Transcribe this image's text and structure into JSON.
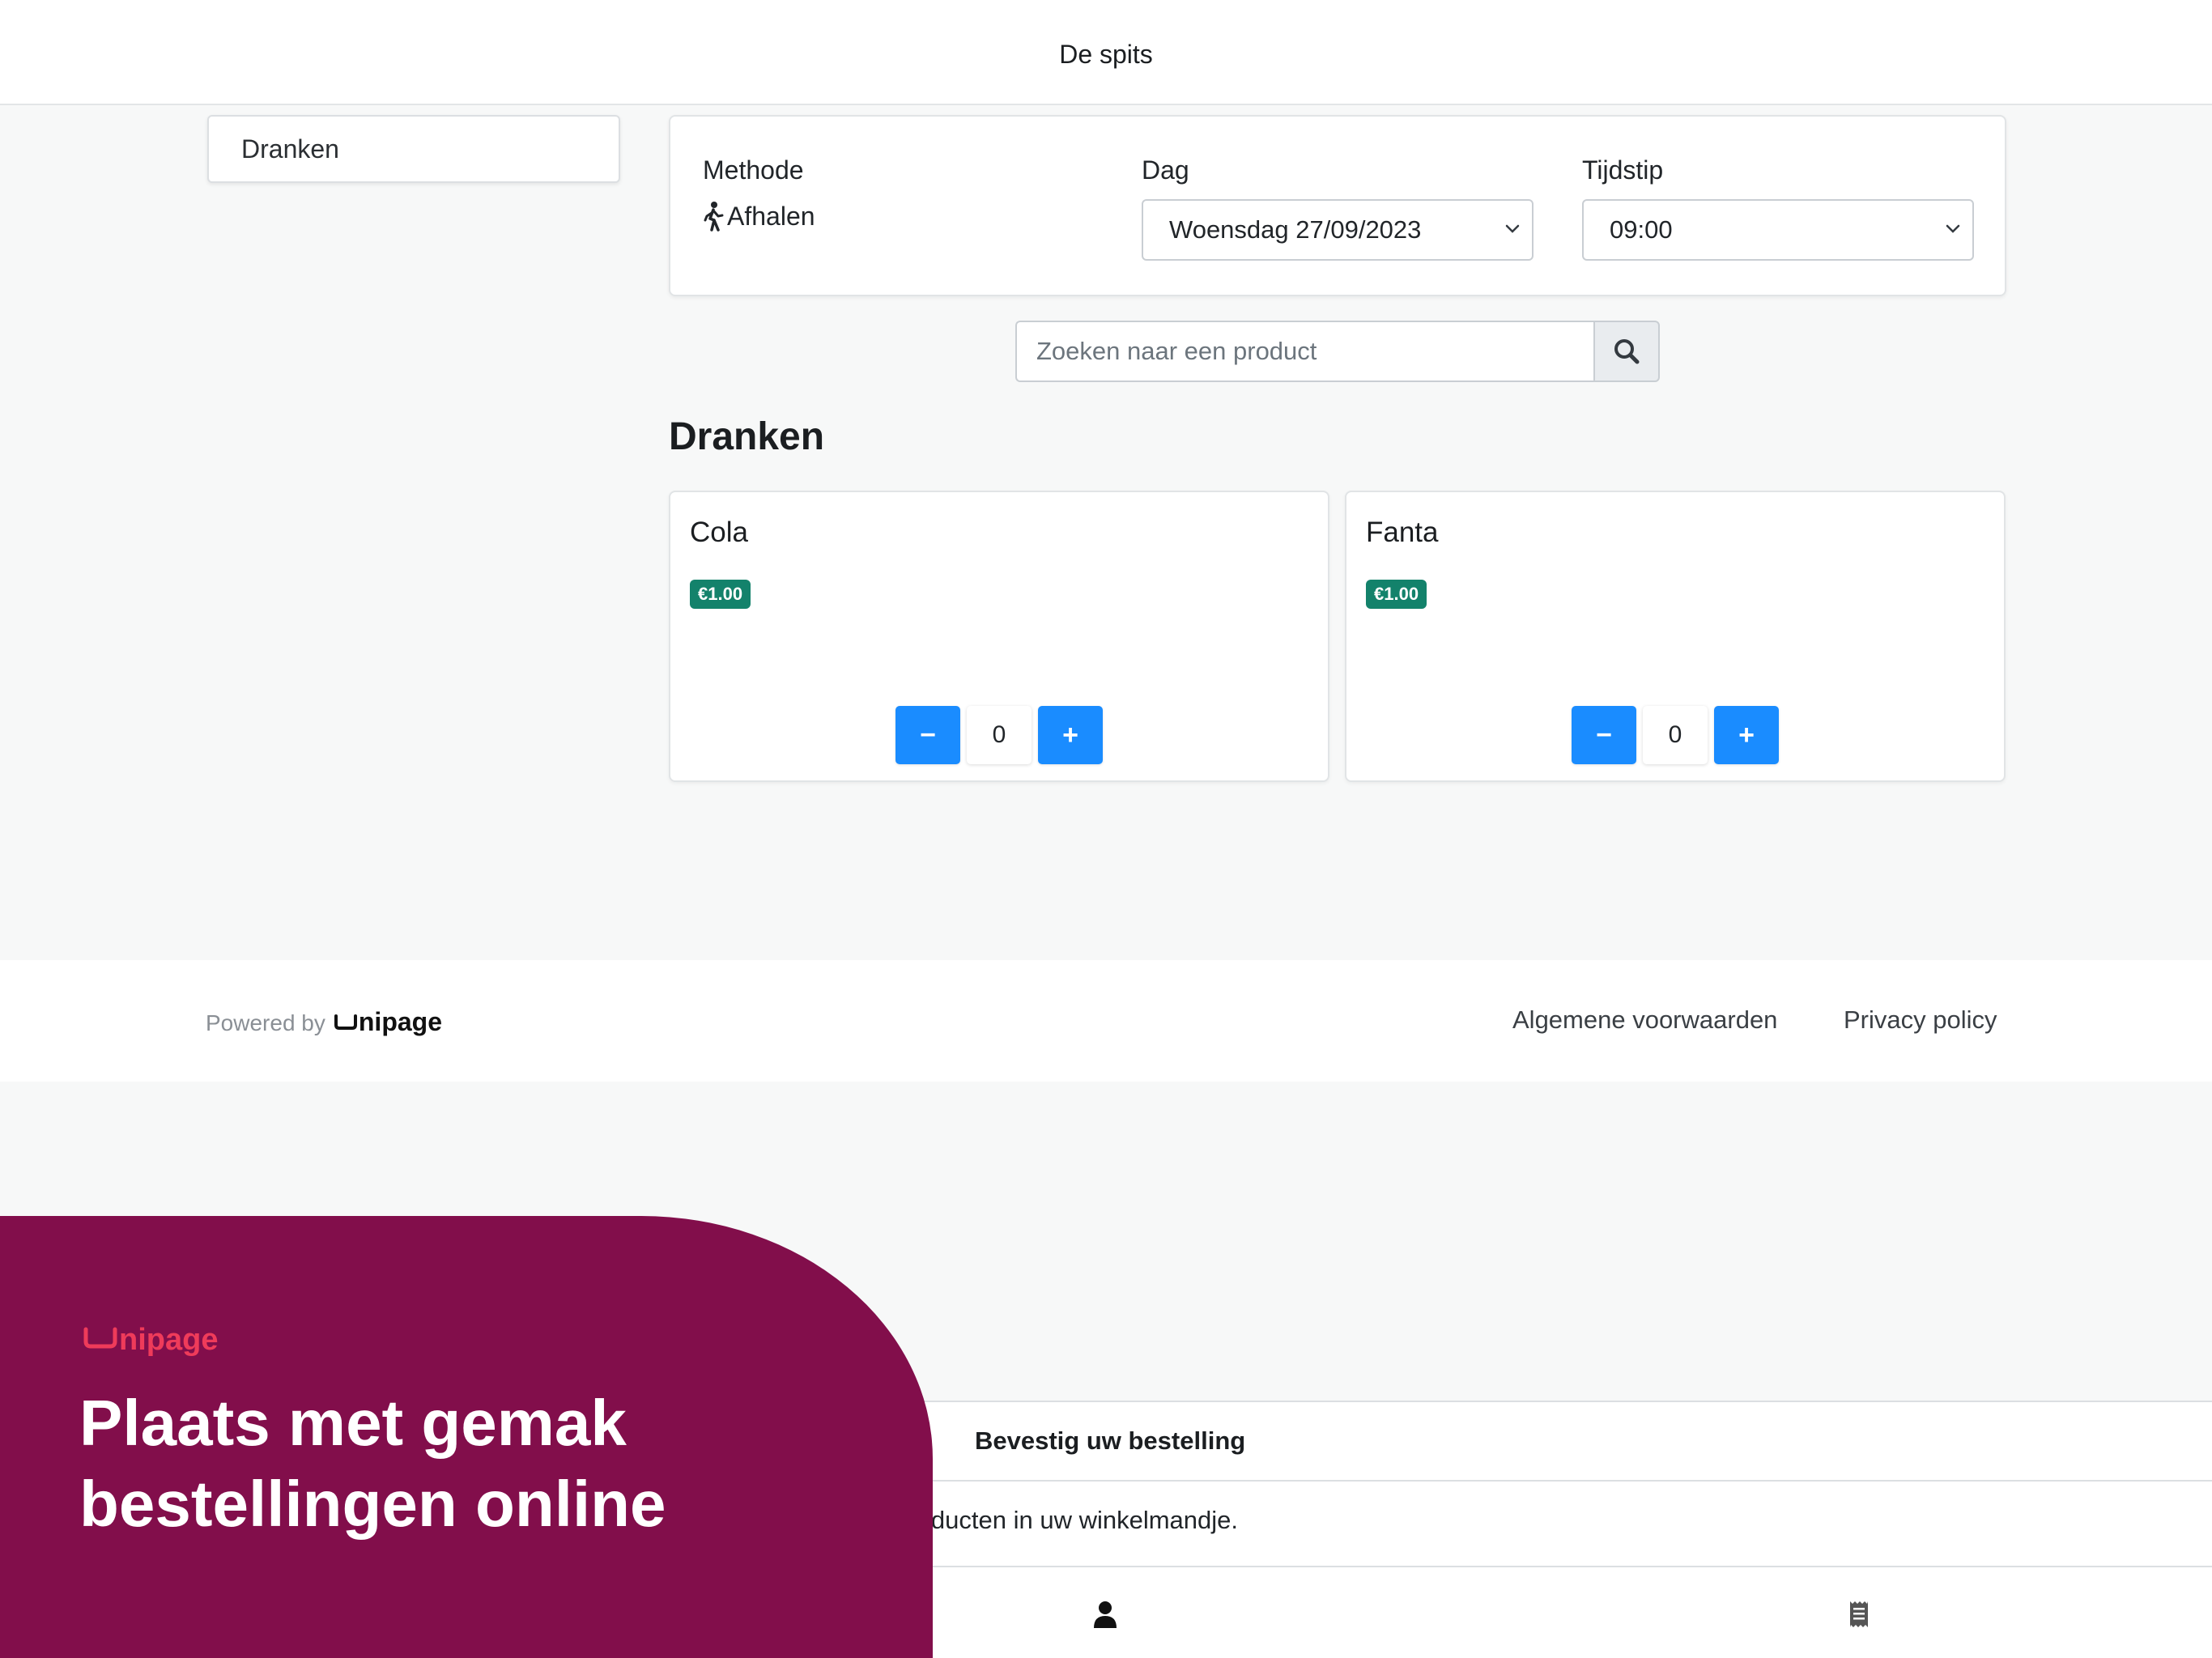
{
  "header": {
    "title": "De spits"
  },
  "sidebar": {
    "categories": [
      {
        "label": "Dranken"
      }
    ]
  },
  "order_options": {
    "method": {
      "label": "Methode",
      "value": "Afhalen",
      "icon": "walking-person-icon"
    },
    "day": {
      "label": "Dag",
      "selected": "Woensdag 27/09/2023"
    },
    "time": {
      "label": "Tijdstip",
      "selected": "09:00"
    }
  },
  "search": {
    "placeholder": "Zoeken naar een product",
    "icon": "search-icon"
  },
  "section": {
    "title": "Dranken"
  },
  "products": [
    {
      "name": "Cola",
      "price": "€1.00",
      "quantity": "0",
      "minus": "−",
      "plus": "+"
    },
    {
      "name": "Fanta",
      "price": "€1.00",
      "quantity": "0",
      "minus": "−",
      "plus": "+"
    }
  ],
  "footer": {
    "powered_by": "Powered by",
    "brand": "nipage",
    "links": [
      "Algemene voorwaarden",
      "Privacy policy"
    ]
  },
  "cart": {
    "confirm_label": "Bevestig uw bestelling",
    "message": "en producten in uw winkelmandje."
  },
  "bottom_nav": {
    "items": [
      "user-icon",
      "receipt-icon"
    ]
  },
  "promo": {
    "brand": "nipage",
    "headline_line1": "Plaats met gemak",
    "headline_line2": "bestellingen online"
  },
  "colors": {
    "primary_button": "#1a8cff",
    "price_badge": "#13826b",
    "promo_background": "#820e4b",
    "promo_brand": "#ef3b5a"
  }
}
